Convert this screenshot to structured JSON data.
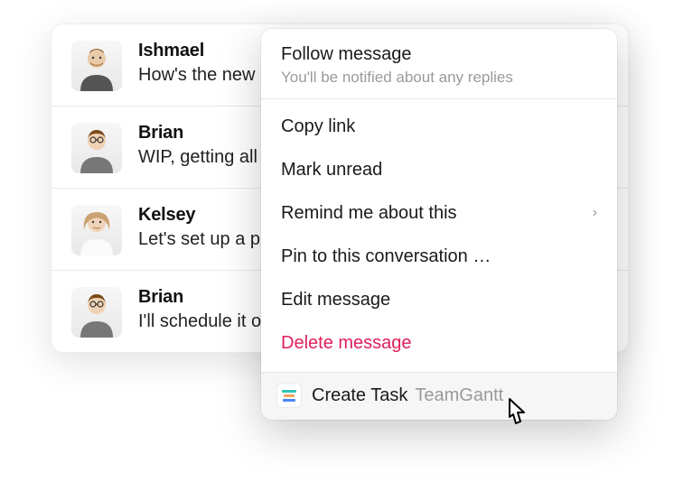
{
  "messages": [
    {
      "author": "Ishmael",
      "text": "How's the new p"
    },
    {
      "author": "Brian",
      "text": "WIP, getting all t"
    },
    {
      "author": "Kelsey",
      "text": "Let's set up a pro"
    },
    {
      "author": "Brian",
      "text": "I'll schedule it ou"
    }
  ],
  "menu": {
    "follow": {
      "title": "Follow message",
      "subtitle": "You'll be notified about any replies"
    },
    "copy_link": "Copy link",
    "mark_unread": "Mark unread",
    "remind": "Remind me about this",
    "pin": "Pin to this conversation …",
    "edit": "Edit message",
    "delete": "Delete message",
    "app": {
      "label": "Create Task",
      "name": "TeamGantt"
    }
  }
}
